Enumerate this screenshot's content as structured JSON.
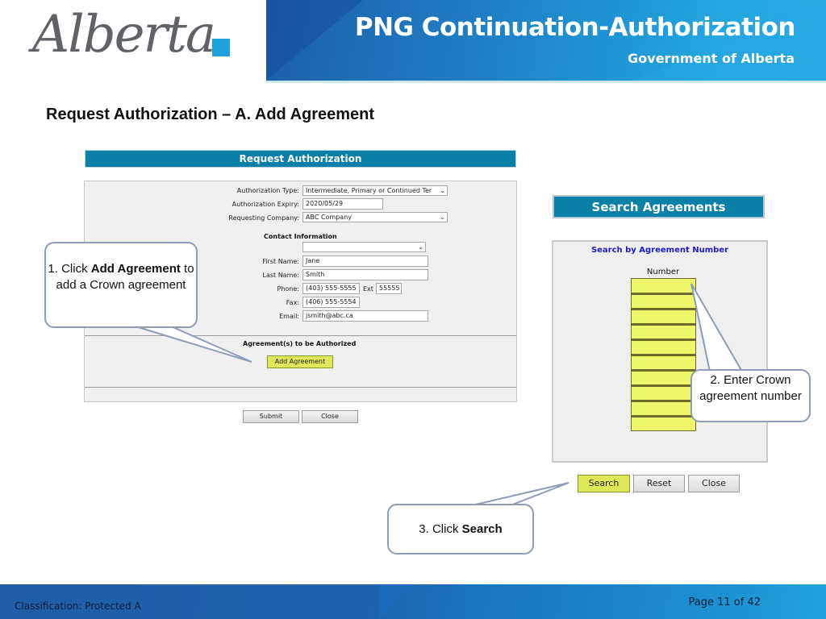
{
  "header": {
    "logo_text": "Alberta",
    "title": "PNG Continuation-Authorization",
    "subtitle": "Government of Alberta"
  },
  "slide_heading": "Request Authorization – A. Add Agreement",
  "request_authorization": {
    "panel_title": "Request Authorization",
    "fields": {
      "authorization_type": {
        "label": "Authorization Type:",
        "value": "Intermediate, Primary or Continued Ter"
      },
      "authorization_expiry": {
        "label": "Authorization Expiry:",
        "value": "2020/05/29"
      },
      "requesting_company": {
        "label": "Requesting Company:",
        "value": "ABC Company"
      }
    },
    "contact_section_label": "Contact Information",
    "contact_select_value": "",
    "contact": {
      "first_name": {
        "label": "First Name:",
        "value": "Jane"
      },
      "last_name": {
        "label": "Last Name:",
        "value": "Smith"
      },
      "phone": {
        "label": "Phone:",
        "value": "(403) 555-5555"
      },
      "ext": {
        "label": "Ext",
        "value": "55555"
      },
      "fax": {
        "label": "Fax:",
        "value": "(406) 555-5554"
      },
      "email": {
        "label": "Email:",
        "value": "jsmith@abc.ca"
      }
    },
    "agreements_section_label": "Agreement(s) to be Authorized",
    "add_agreement_button": "Add Agreement",
    "submit_button": "Submit",
    "close_button": "Close"
  },
  "search_agreements": {
    "panel_title": "Search Agreements",
    "subtitle": "Search by Agreement Number",
    "column_label": "Number",
    "number_fields": [
      "",
      "",
      "",
      "",
      "",
      "",
      "",
      "",
      "",
      ""
    ],
    "search_button": "Search",
    "reset_button": "Reset",
    "close_button": "Close"
  },
  "callouts": {
    "step1": {
      "prefix": "1.  Click ",
      "bold": "Add Agreement",
      "suffix": "  to add a Crown agreement"
    },
    "step2": {
      "text": "2. Enter Crown agreement number"
    },
    "step3": {
      "prefix": "3. Click ",
      "bold": "Search"
    }
  },
  "colors": {
    "panel_header": "#0a7fa8",
    "highlight_button": "#dfe85a",
    "number_field": "#eef86a",
    "search_subtitle": "#1a1ad0",
    "callout_border": "#8d9db8"
  },
  "footer": {
    "classification": "Classification: Protected A",
    "page": "Page 11 of 42"
  }
}
